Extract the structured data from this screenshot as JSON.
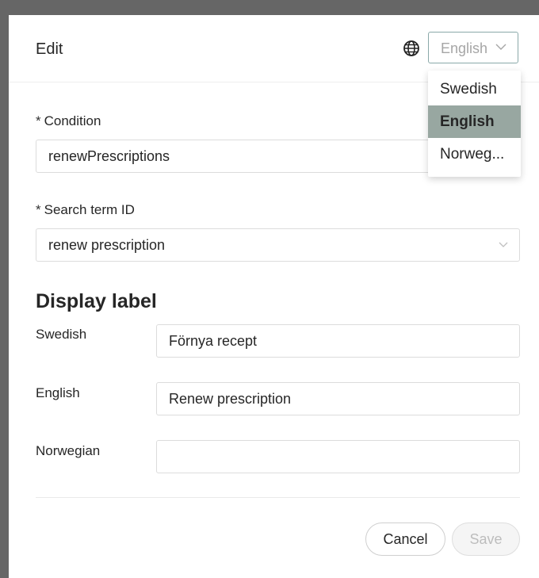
{
  "dialog": {
    "title": "Edit"
  },
  "language": {
    "selected": "English",
    "options": [
      "Swedish",
      "English",
      "Norweg..."
    ],
    "selected_index": 1
  },
  "form": {
    "condition": {
      "label": "Condition",
      "required_mark": "*",
      "value": "renewPrescriptions"
    },
    "search_term": {
      "label": "Search term ID",
      "required_mark": "*",
      "value": "renew prescription"
    }
  },
  "display_label": {
    "heading": "Display label",
    "rows": [
      {
        "label": "Swedish",
        "value": "Förnya recept"
      },
      {
        "label": "English",
        "value": "Renew prescription"
      },
      {
        "label": "Norwegian",
        "value": ""
      }
    ]
  },
  "footer": {
    "cancel_label": "Cancel",
    "save_label": "Save"
  },
  "colors": {
    "selected_option_bg": "#98a7a1",
    "select_border": "#8aa9a9",
    "overlay_frame": "#666666"
  }
}
